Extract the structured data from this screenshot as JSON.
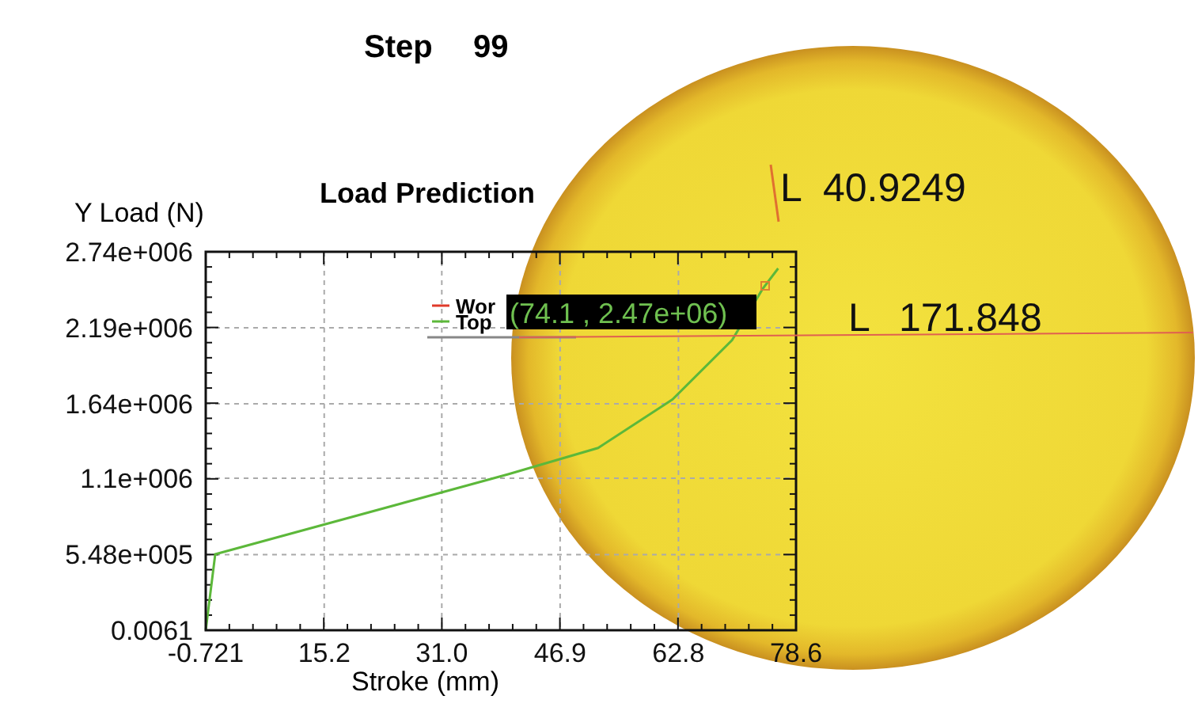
{
  "step": {
    "label": "Step",
    "value": "99"
  },
  "chart": {
    "chart_data": {
      "type": "line",
      "title": "Load Prediction",
      "xlabel": "Stroke (mm)",
      "ylabel": "Y Load (N)",
      "x": [
        -0.721,
        0.56,
        40,
        52,
        62,
        70,
        74.1,
        76.2
      ],
      "series": [
        {
          "name": "Wor",
          "color": "#e03a2a",
          "values": [
            null,
            null,
            null,
            null,
            null,
            null,
            null,
            null
          ]
        },
        {
          "name": "Top",
          "color": "#5cb83a",
          "values": [
            0,
            550000,
            1130000,
            1320000,
            1670000,
            2100000,
            2470000,
            2620000
          ]
        }
      ],
      "grid": true,
      "legend": true,
      "xlim": [
        -0.721,
        78.6
      ],
      "ylim": [
        0,
        2740000
      ],
      "xticks": [
        {
          "value": -0.721,
          "label": "-0.721"
        },
        {
          "value": 15.2,
          "label": "15.2"
        },
        {
          "value": 31.0,
          "label": "31.0"
        },
        {
          "value": 46.9,
          "label": "46.9"
        },
        {
          "value": 62.8,
          "label": "62.8"
        },
        {
          "value": 78.6,
          "label": "78.6"
        }
      ],
      "yticks": [
        {
          "value": 0.0061,
          "label": "0.0061"
        },
        {
          "value": 548000,
          "label": "5.48e+005"
        },
        {
          "value": 1100000,
          "label": "1.1e+006"
        },
        {
          "value": 1640000,
          "label": "1.64e+006"
        },
        {
          "value": 2190000,
          "label": "2.19e+006"
        },
        {
          "value": 2740000,
          "label": "2.74e+006"
        }
      ]
    },
    "tooltip": "(74.1 , 2.47e+06)"
  },
  "measurements": [
    {
      "kind": "vertical",
      "symbol": "L",
      "value": "40.9249"
    },
    {
      "kind": "horizontal",
      "symbol": "L",
      "value": "171.848"
    }
  ]
}
